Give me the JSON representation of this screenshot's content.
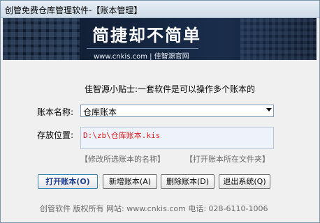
{
  "window": {
    "title": "创管免费仓库管理软件-【账本管理】"
  },
  "banner": {
    "slogan": "简捷却不简单",
    "site": "www.cnkis.com | 佳智源官网"
  },
  "tip": "佳智源小贴士:一套软件是可以操作多个账本的",
  "form": {
    "name_label": "账本名称:",
    "name_value": "仓库账本",
    "path_label": "存放位置:",
    "path_value": "D:\\zb\\仓库账本.kis"
  },
  "links": {
    "rename": "【修改所选账本的名称】",
    "open_folder": "【打开账本所在文件夹】"
  },
  "buttons": {
    "open": "打开账本(O)",
    "add": "新增账本(A)",
    "delete": "删除账本(D)",
    "exit": "退出系统(Q)"
  },
  "footer": "创管软件 版权所有 网站: www.cnkis.com  电话: 028-6110-1006"
}
